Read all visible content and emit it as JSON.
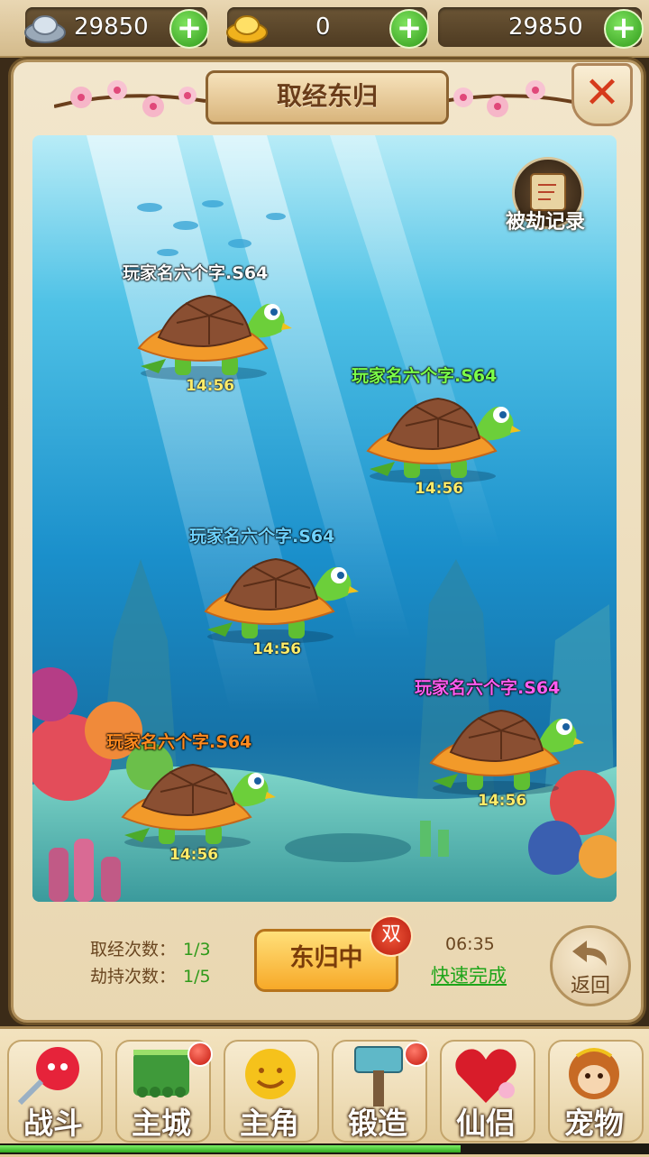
{
  "currencies": [
    {
      "name": "silver",
      "value": "29850",
      "icon": "silver-ingot-icon"
    },
    {
      "name": "gold",
      "value": "0",
      "icon": "gold-ingot-icon"
    },
    {
      "name": "third",
      "value": "29850"
    }
  ],
  "title": "取经东归",
  "robbed_record_label": "被劫记录",
  "turtles": [
    {
      "name": "玩家名六个字.S64",
      "time": "14:56",
      "name_color": "#ffffff"
    },
    {
      "name": "玩家名六个字.S64",
      "time": "14:56",
      "name_color": "#7cff4a"
    },
    {
      "name": "玩家名六个字.S64",
      "time": "14:56",
      "name_color": "#6fd3ff"
    },
    {
      "name": "玩家名六个字.S64",
      "time": "14:56",
      "name_color": "#ff5cf0"
    },
    {
      "name": "玩家名六个字.S64",
      "time": "14:56",
      "name_color": "#ff8a1e"
    }
  ],
  "stats": {
    "fetch_label": "取经次数：",
    "fetch_value": "1/3",
    "rob_label": "劫持次数：",
    "rob_value": "1/5"
  },
  "main_button": "东归中",
  "double_badge": "双",
  "countdown": "06:35",
  "quick_finish": "快速完成",
  "back_label": "返回",
  "nav": [
    {
      "label": "战斗",
      "icon": "battle-icon",
      "badge": false
    },
    {
      "label": "主城",
      "icon": "city-icon",
      "badge": true
    },
    {
      "label": "主角",
      "icon": "hero-icon",
      "badge": false
    },
    {
      "label": "锻造",
      "icon": "forge-icon",
      "badge": true
    },
    {
      "label": "仙侣",
      "icon": "companion-icon",
      "badge": false
    },
    {
      "label": "宠物",
      "icon": "pet-icon",
      "badge": false
    }
  ],
  "exp_progress": 0.71,
  "colors": {
    "accent": "#f7a928",
    "green": "#2f9a1a",
    "frame": "#b08f5a"
  }
}
